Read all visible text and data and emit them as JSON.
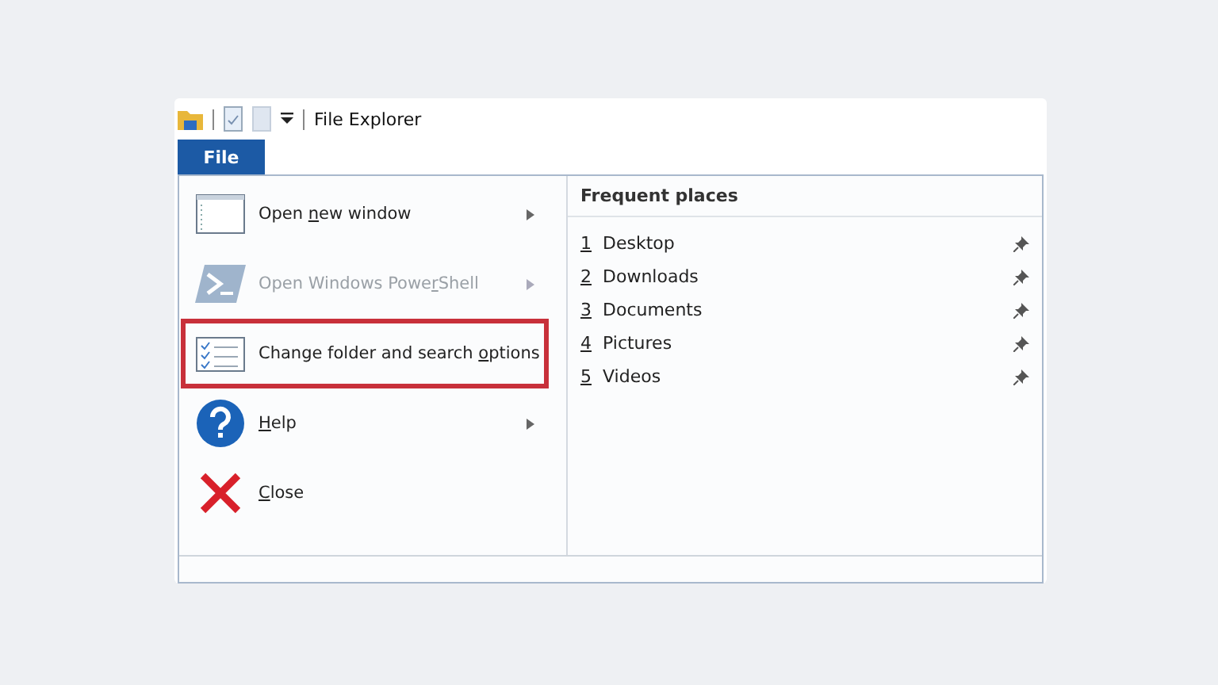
{
  "window": {
    "title": "File Explorer"
  },
  "file_tab": {
    "label": "File",
    "selected": true
  },
  "menu_items": [
    {
      "label": {
        "before": "Open ",
        "key": "n",
        "after": "ew window"
      },
      "disabled": false,
      "highlighted": false,
      "submenu": true
    },
    {
      "label": {
        "before": "Open Windows Powe",
        "key": "r",
        "after": "Shell"
      },
      "disabled": true,
      "highlighted": false,
      "submenu": true
    },
    {
      "label": {
        "before": "Change folder and search ",
        "key": "o",
        "after": "ptions"
      },
      "disabled": false,
      "highlighted": true,
      "submenu": false
    },
    {
      "label": {
        "key": "H",
        "after": "elp"
      },
      "disabled": false,
      "highlighted": false,
      "submenu": true
    },
    {
      "label": {
        "key": "C",
        "after": "lose"
      },
      "disabled": false,
      "highlighted": false,
      "submenu": false
    }
  ],
  "frequent_places": {
    "title": "Frequent places",
    "items": [
      {
        "number": "1",
        "name": "Desktop",
        "pinned": true
      },
      {
        "number": "2",
        "name": "Downloads",
        "pinned": true
      },
      {
        "number": "3",
        "name": "Documents",
        "pinned": true
      },
      {
        "number": "4",
        "name": "Pictures",
        "pinned": true
      },
      {
        "number": "5",
        "name": "Videos",
        "pinned": true
      }
    ]
  }
}
